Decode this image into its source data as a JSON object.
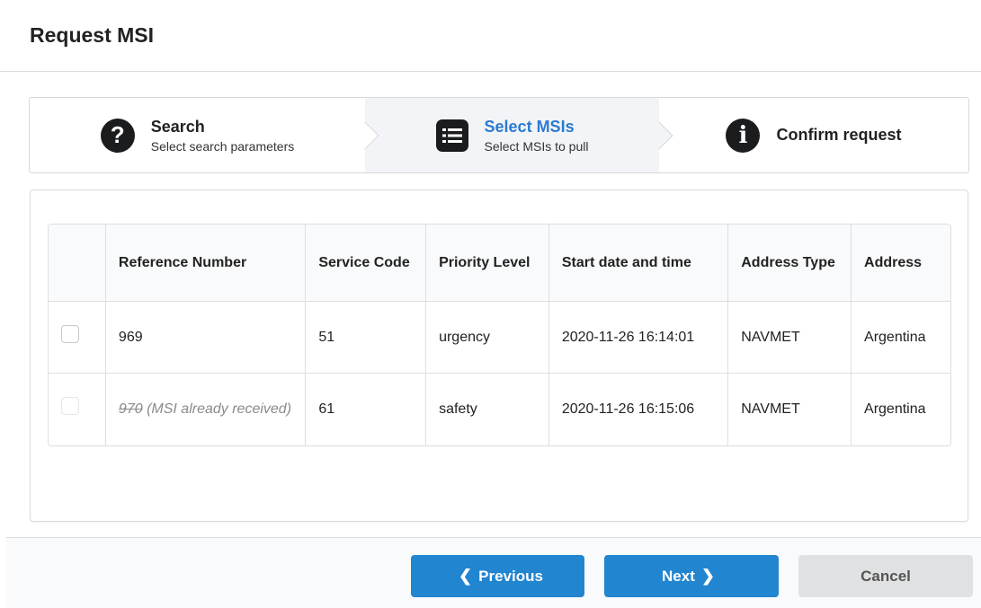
{
  "page": {
    "title": "Request MSI"
  },
  "steps": [
    {
      "title": "Search",
      "description": "Select search parameters",
      "icon": "question-circle-icon",
      "glyph": "?"
    },
    {
      "title": "Select MSIs",
      "description": "Select MSIs to pull",
      "icon": "list-icon",
      "active": true
    },
    {
      "title": "Confirm request",
      "description": "",
      "icon": "info-circle-icon",
      "glyph": "i"
    }
  ],
  "table": {
    "headers": {
      "checkbox": "",
      "reference": "Reference Number",
      "service": "Service Code",
      "priority": "Priority Level",
      "start": "Start date and time",
      "address_type": "Address Type",
      "address": "Address"
    },
    "rows": [
      {
        "reference": "969",
        "note": "",
        "service": "51",
        "priority": "urgency",
        "start": "2020-11-26 16:14:01",
        "address_type": "NAVMET",
        "address": "Argentina",
        "disabled": false
      },
      {
        "reference": "970",
        "note": " (MSI already received)",
        "service": "61",
        "priority": "safety",
        "start": "2020-11-26 16:15:06",
        "address_type": "NAVMET",
        "address": "Argentina",
        "disabled": true
      }
    ]
  },
  "footer": {
    "previous_label": "Previous",
    "next_label": "Next",
    "cancel_label": "Cancel"
  },
  "colors": {
    "primary": "#2185d0",
    "active_step": "#2b7ad0",
    "cancel_bg": "#e0e1e2"
  }
}
